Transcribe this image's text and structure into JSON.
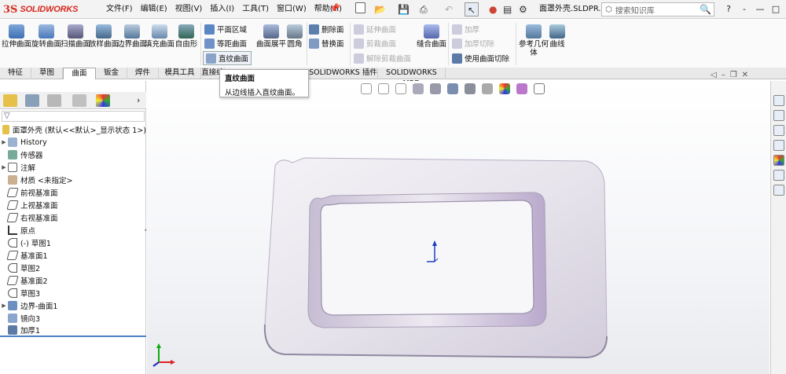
{
  "app": {
    "logo_mark": "3S",
    "logo_text": "SOLIDWORKS",
    "doc_title": "面罩外壳.SLDPR..."
  },
  "menu": [
    "文件(F)",
    "编辑(E)",
    "视图(V)",
    "插入(I)",
    "工具(T)",
    "窗口(W)",
    "帮助(H)"
  ],
  "search": {
    "placeholder": "搜索知识库"
  },
  "window_controls": [
    "?",
    "-",
    "—",
    "□",
    "✕"
  ],
  "ribbon": {
    "large": [
      "拉伸曲面",
      "旋转曲面",
      "扫描曲面",
      "放样曲面",
      "边界曲面",
      "填充曲面",
      "自由形"
    ],
    "group1": [
      "平面区域",
      "等距曲面",
      "直纹曲面"
    ],
    "expand": "曲面展平",
    "round": "圆角",
    "group2": [
      "删除面",
      "替换面"
    ],
    "group3": [
      "延伸曲面",
      "剪裁曲面",
      "解除剪裁曲面"
    ],
    "knit": "缝合曲面",
    "group4": [
      "加厚",
      "加厚切除",
      "使用曲面切除"
    ],
    "refgeom": "参考几何体",
    "curves": "曲线"
  },
  "tabs": [
    "特征",
    "草图",
    "曲面",
    "钣金",
    "焊件",
    "模具工具",
    "直接编辑",
    "评估",
    "DimXpert",
    "SOLIDWORKS 插件",
    "SOLIDWORKS MBD"
  ],
  "active_tab": "曲面",
  "tooltip": {
    "title": "直纹曲面",
    "desc": "从边线插入直纹曲面。"
  },
  "tree": {
    "root": "面罩外壳 (默认<<默认>_显示状态 1>)",
    "items": [
      {
        "label": "History",
        "expand": true
      },
      {
        "label": "传感器",
        "expand": false
      },
      {
        "label": "注解",
        "expand": true
      },
      {
        "label": "材质 <未指定>",
        "expand": false
      },
      {
        "label": "前视基准面",
        "expand": false
      },
      {
        "label": "上视基准面",
        "expand": false
      },
      {
        "label": "右视基准面",
        "expand": false
      },
      {
        "label": "原点",
        "expand": false
      },
      {
        "label": "(-) 草图1",
        "expand": false
      },
      {
        "label": "基准面1",
        "expand": false
      },
      {
        "label": "草图2",
        "expand": false
      },
      {
        "label": "基准面2",
        "expand": false
      },
      {
        "label": "草图3",
        "expand": false
      },
      {
        "label": "边界-曲面1",
        "expand": true
      },
      {
        "label": "镜向3",
        "expand": false
      },
      {
        "label": "加厚1",
        "expand": false
      }
    ]
  },
  "colors": {
    "brand": "#d8281f",
    "model": "#ece9f0"
  }
}
